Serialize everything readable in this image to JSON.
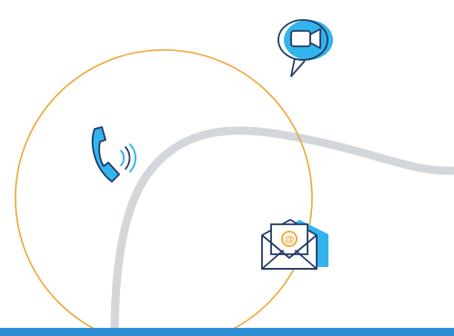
{
  "colors": {
    "background": "#ffffff",
    "curve": "#d3d6da",
    "circle": "#f0a431",
    "accent_blue": "#33b4ec",
    "ink_navy": "#233a66",
    "email_orange": "#f3a12f",
    "bottom_bar": "#2f8ed4"
  },
  "icons": {
    "video_call": "video-chat-bubble-icon",
    "phone": "phone-ringing-icon",
    "email": "email-envelope-icon"
  },
  "email": {
    "symbol": "@"
  }
}
